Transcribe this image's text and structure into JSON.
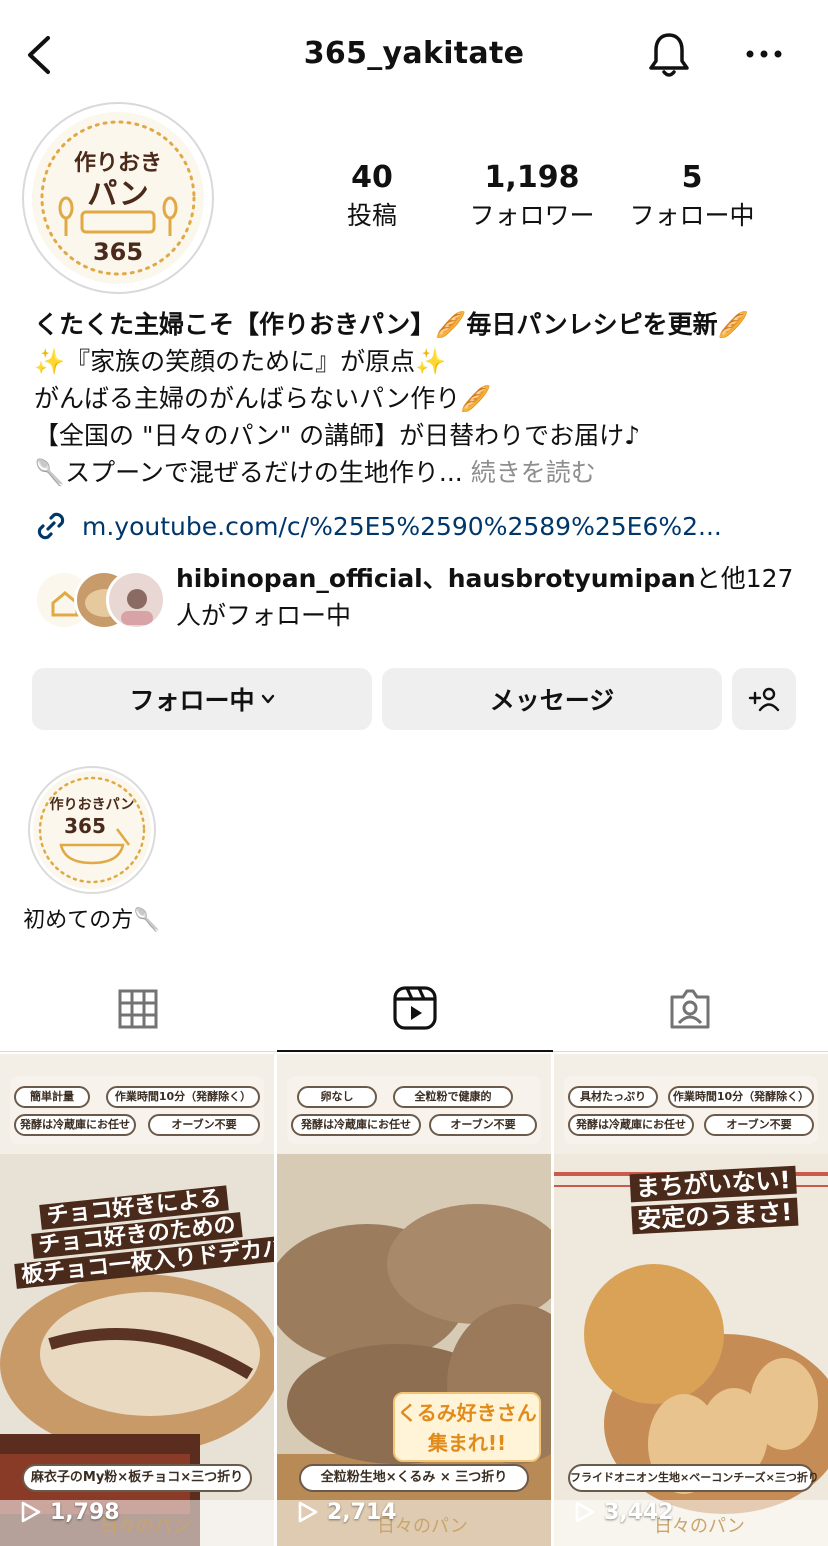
{
  "header": {
    "username": "365_yakitate"
  },
  "profile": {
    "avatar_text_top": "作りおき",
    "avatar_text_mid": "パン",
    "avatar_text_num": "365",
    "stats": [
      {
        "value": "40",
        "label": "投稿"
      },
      {
        "value": "1,198",
        "label": "フォロワー"
      },
      {
        "value": "5",
        "label": "フォロー中"
      }
    ]
  },
  "bio": {
    "line1": "くたくた主婦こそ【作りおきパン】🥖毎日パンレシピを更新🥖",
    "line2": "✨『家族の笑顔のために』が原点✨",
    "line3": "がんばる主婦のがんばらないパン作り🥖",
    "line4": "【全国の \"日々のパン\" の講師】が日替わりでお届け♪",
    "line5": "🥄スプーンで混ぜるだけの生地作り...",
    "more": "続きを読む"
  },
  "link": {
    "text": "m.youtube.com/c/%25E5%2590%2589%25E6%2..."
  },
  "followed_by": {
    "names": "hibinopan_official、hausbrotyumipan",
    "suffix": "と他127",
    "line2": "人がフォロー中"
  },
  "buttons": {
    "following": "フォロー中",
    "message": "メッセージ"
  },
  "highlights": [
    {
      "label": "初めての方🥄",
      "title_top": "作りおきパン",
      "title_num": "365"
    }
  ],
  "tabs": [
    "grid",
    "reels",
    "tagged"
  ],
  "reels": [
    {
      "tags": [
        "簡単計量",
        "作業時間10分（発酵除く）",
        "発酵は冷蔵庫にお任せ",
        "オーブン不要"
      ],
      "headline": [
        "チョコ好きによる",
        "チョコ好きのための",
        "板チョコ一枚入りドデカパン"
      ],
      "caption": "麻衣子のMy粉×板チョコ×三つ折り",
      "views": "1,798",
      "brand": "日々のパン"
    },
    {
      "tags": [
        "卵なし",
        "全粒粉で健康的",
        "発酵は冷蔵庫にお任せ",
        "オーブン不要"
      ],
      "callout": [
        "くるみ好きさん",
        "集まれ!!"
      ],
      "caption": "全粒粉生地×くるみ × 三つ折り",
      "views": "2,714",
      "brand": "日々のパン"
    },
    {
      "tags": [
        "具材たっぷり",
        "作業時間10分（発酵除く）",
        "発酵は冷蔵庫にお任せ",
        "オーブン不要"
      ],
      "headline": [
        "まちがいない!",
        "安定のうまさ!"
      ],
      "caption": "フライドオニオン生地×ベーコンチーズ×三つ折り",
      "views": "3,442",
      "brand": "日々のパン"
    }
  ]
}
